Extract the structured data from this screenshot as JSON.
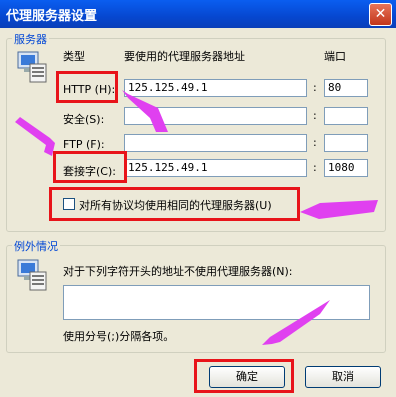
{
  "window": {
    "title": "代理服务器设置",
    "close_symbol": "✕"
  },
  "servers": {
    "group_label": "服务器",
    "col_type": "类型",
    "col_address": "要使用的代理服务器地址",
    "col_port": "端口",
    "rows": [
      {
        "label": "HTTP (H):",
        "address": "125.125.49.1",
        "port": "80"
      },
      {
        "label": "安全(S):",
        "address": "",
        "port": ""
      },
      {
        "label": "FTP (F):",
        "address": "",
        "port": ""
      },
      {
        "label": "套接字(C):",
        "address": "125.125.49.1",
        "port": "1080"
      }
    ],
    "same_proxy_label": "对所有协议均使用相同的代理服务器(U)",
    "same_proxy_checked": false
  },
  "exceptions": {
    "group_label": "例外情况",
    "description": "对于下列字符开头的地址不使用代理服务器(N):",
    "value": "",
    "hint": "使用分号(;)分隔各项。"
  },
  "buttons": {
    "ok": "确定",
    "cancel": "取消"
  },
  "annotation_color": "#e8141a",
  "arrow_color": "#e040f0"
}
